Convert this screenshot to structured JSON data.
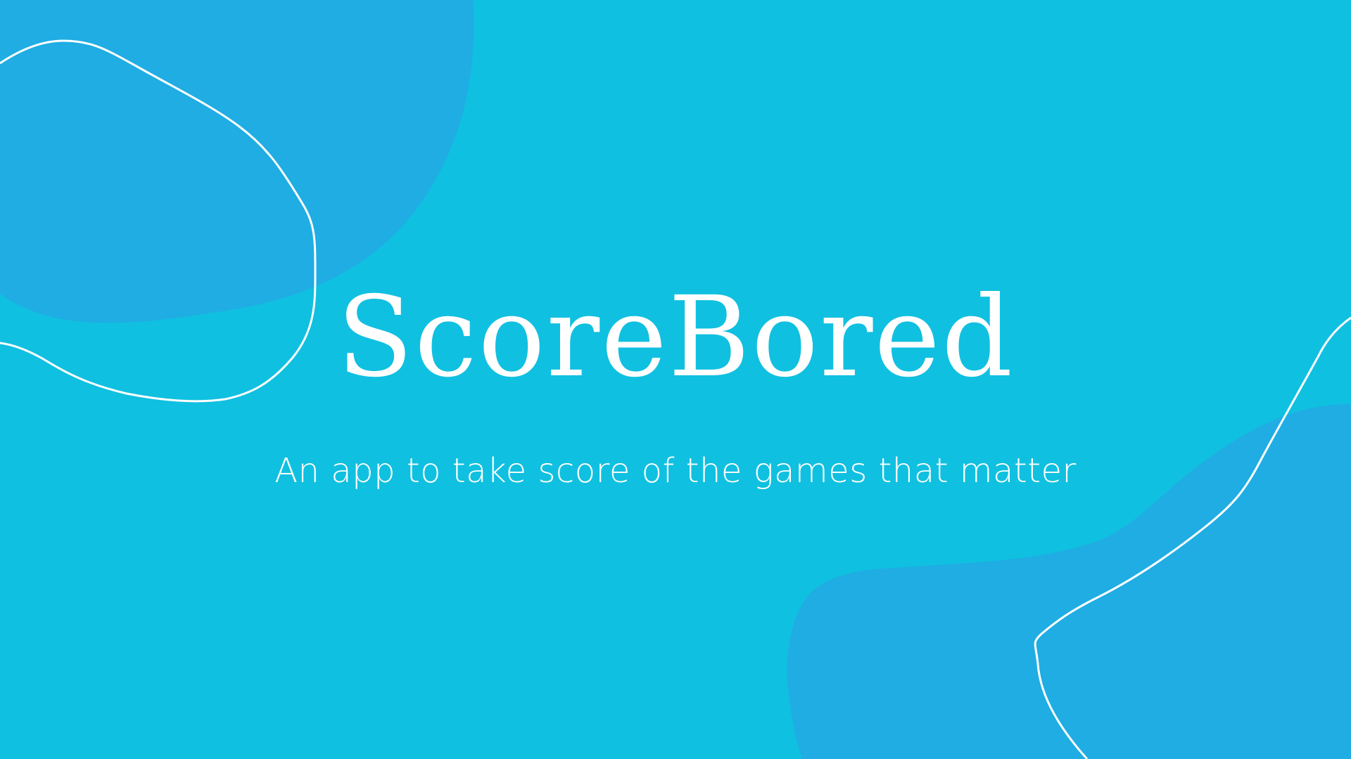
{
  "app": {
    "title": "ScoreBored",
    "tagline": "An app to take score of the games that matter"
  },
  "colors": {
    "background": "#10c0e0",
    "blob": "#1fade3",
    "outline": "#ffffff",
    "text": "#ffffff"
  },
  "decorations": {
    "top_left_blob": "blob-shape",
    "top_left_outline": "outline-curve",
    "bottom_right_blob": "blob-shape",
    "bottom_right_outline": "outline-curve"
  }
}
